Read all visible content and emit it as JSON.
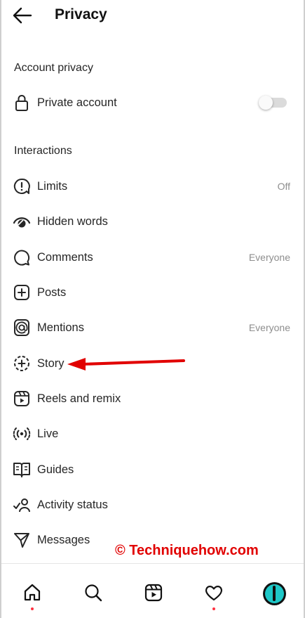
{
  "header": {
    "title": "Privacy",
    "back_icon": "arrow-left-icon"
  },
  "account_privacy": {
    "heading": "Account privacy",
    "private_account": {
      "label": "Private account",
      "icon": "lock-icon",
      "enabled": false
    }
  },
  "interactions": {
    "heading": "Interactions",
    "items": [
      {
        "label": "Limits",
        "value": "Off",
        "icon": "limits-icon"
      },
      {
        "label": "Hidden words",
        "value": "",
        "icon": "hidden-words-icon"
      },
      {
        "label": "Comments",
        "value": "Everyone",
        "icon": "comment-icon"
      },
      {
        "label": "Posts",
        "value": "",
        "icon": "plus-square-icon"
      },
      {
        "label": "Mentions",
        "value": "Everyone",
        "icon": "at-sign-icon"
      },
      {
        "label": "Story",
        "value": "",
        "icon": "story-plus-icon"
      },
      {
        "label": "Reels and remix",
        "value": "",
        "icon": "reels-icon"
      },
      {
        "label": "Live",
        "value": "",
        "icon": "live-icon"
      },
      {
        "label": "Guides",
        "value": "",
        "icon": "guides-icon"
      },
      {
        "label": "Activity status",
        "value": "",
        "icon": "activity-status-icon"
      },
      {
        "label": "Messages",
        "value": "",
        "icon": "messages-icon"
      }
    ]
  },
  "annotation": {
    "watermark": "© Techniquehow.com",
    "arrow_color": "#e10000"
  },
  "bottom_nav": {
    "items": [
      "home-icon",
      "search-icon",
      "reels-icon",
      "heart-icon",
      "profile-avatar"
    ]
  },
  "colors": {
    "text": "#262626",
    "secondary": "#8e8e8e",
    "notification_dot": "#ff3040"
  }
}
